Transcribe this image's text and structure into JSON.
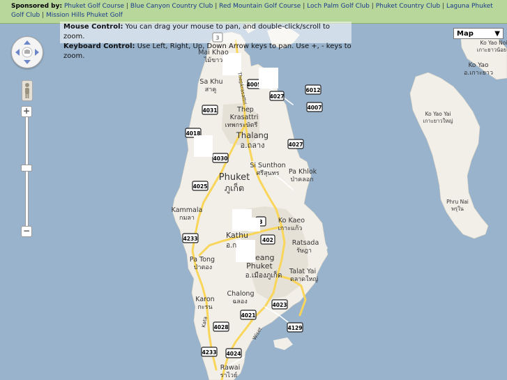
{
  "sponsor": {
    "label": "Sponsored by:",
    "links": [
      "Phuket Golf Course",
      "Blue Canyon Country Club",
      "Red Mountain Golf Course",
      "Loch Palm Golf Club",
      "Phuket Country Club",
      "Laguna Phuket Golf Club",
      "Mission Hills Phuket Golf"
    ],
    "separator": "|"
  },
  "help": {
    "mouse_label": "Mouse Control:",
    "mouse_text": " You can drag your mouse to pan, and double-click/scroll to zoom.",
    "keyboard_label": "Keyboard Control:",
    "keyboard_text": " Use Left, Right, Up, Down Arrow keys to pan. Use +, - keys to zoom."
  },
  "map_type": {
    "selected": "Map",
    "arrow": "▼"
  },
  "zoom": {
    "plus": "+",
    "minus": "−"
  },
  "icons": {
    "pan": "pan-control-icon",
    "pegman": "street-view-pegman-icon",
    "zoom_in": "zoom-in-icon",
    "zoom_out": "zoom-out-icon"
  },
  "places": {
    "mai_khao": "Mai Khao",
    "mai_khao_th": "ไม้ขาว",
    "sa_khu": "Sa Khu",
    "sa_khu_th": "สาคู",
    "thep_krasattri": "Thep",
    "thep_krasattri2": "Krasattri",
    "thep_th": "เทพกระษัตรี",
    "thalang": "Thalang",
    "thalang_th": "อ.ถลาง",
    "si_sunthon": "Si Sunthon",
    "si_sunthon_th": "ศรีสุนทร",
    "pa_khlok": "Pa Khlok",
    "pa_khlok_th": "ป่าคลอก",
    "phuket": "Phuket",
    "phuket_th": "ภูเก็ต",
    "kammala": "Kammala",
    "kammala_th": "กมลา",
    "kathu": "Kathu",
    "kathu_th": "อ.ก",
    "ko_kaeo": "Ko Kaeo",
    "ko_kaeo_th": "เกาะแก้ว",
    "ratsada": "Ratsada",
    "ratsada_th": "รัษฎา",
    "mueang": "eang",
    "mueang_phuket": "Phuket",
    "mueang_th": "อ.เมืองภูเก็ต",
    "patong": "Pa Tong",
    "patong_th": "ป่าตอง",
    "talat_yai": "Talat Yai",
    "talat_yai_th": "ตลาดใหญ่",
    "chalong": "Chalong",
    "chalong_th": "ฉลอง",
    "karon": "Karon",
    "karon_th": "กะรน",
    "rawai": "Rawai",
    "rawai_th": "ราไวย์",
    "ko_yao": "Ko Yao",
    "ko_yao_th": "อ.เกาะยาว",
    "ko_yao_noi": "Ko Yao Noi",
    "ko_yao_noi_th": "เกาะยาวน้อย",
    "ko_yao_yai": "Ko Yao Yai",
    "ko_yao_yai_th": "เกาะยาวใหญ่",
    "phru_nai": "Phru Nai",
    "phru_nai_th": "พรุใน",
    "kata": "Kata",
    "wiset": "Wiset",
    "thepkrasattri_rd": "Thepkrasattri"
  },
  "routes": [
    "402",
    "4005",
    "4027",
    "6012",
    "4007",
    "4031",
    "4018",
    "4030",
    "4027",
    "4025",
    "4233",
    "3",
    "402",
    "4023",
    "4021",
    "4028",
    "4129",
    "4233",
    "4024",
    "3"
  ]
}
